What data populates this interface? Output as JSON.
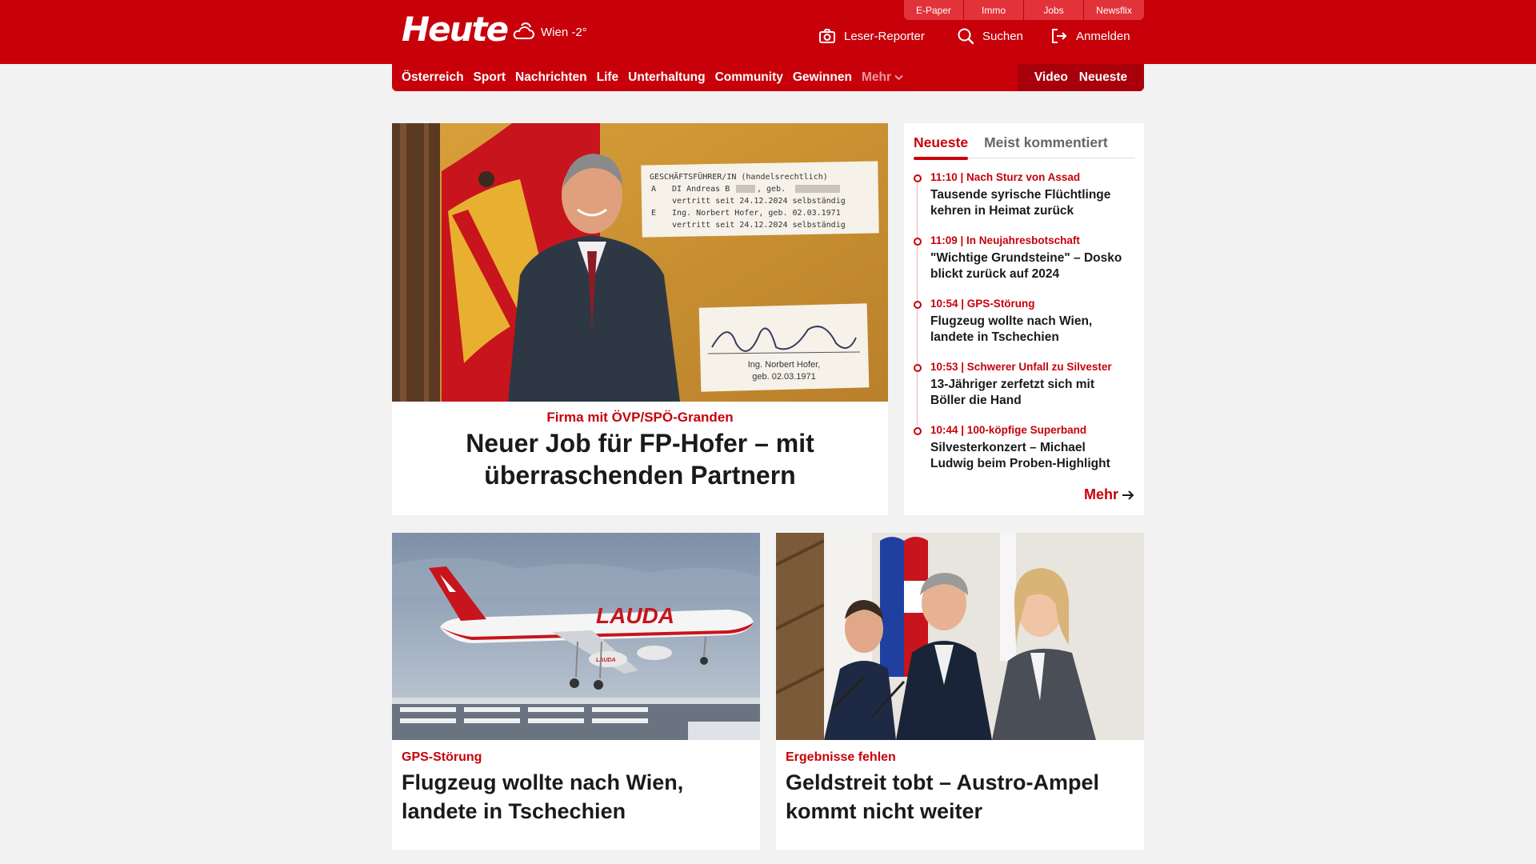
{
  "header": {
    "logo": "Heute",
    "weather": "Wien -2°",
    "service_links": [
      "E-Paper",
      "Immo",
      "Jobs",
      "Newsflix"
    ],
    "reporter": "Leser-Reporter",
    "search": "Suchen",
    "login": "Anmelden"
  },
  "nav": {
    "items": [
      "Österreich",
      "Sport",
      "Nachrichten",
      "Life",
      "Unterhaltung",
      "Community",
      "Gewinnen"
    ],
    "more": "Mehr",
    "video": "Video",
    "latest": "Neueste"
  },
  "lead": {
    "kicker": "Firma mit ÖVP/SPÖ-Granden",
    "title": "Neuer Job für FP-Hofer – mit überraschenden Partnern",
    "document": {
      "heading": "GESCHÄFTSFÜHRER/IN (handelsrechtlich)",
      "line_a_letter": "A",
      "line_a": "DI Andreas B",
      "line_a_suffix": ", geb.",
      "line_a2": "vertritt seit 24.12.2024 selbständig",
      "line_e_letter": "E",
      "line_e": "Ing. Norbert Hofer, geb. 02.03.1971",
      "line_e2": "vertritt seit 24.12.2024 selbständig",
      "sig_name": "Ing. Norbert Hofer,",
      "sig_date": "geb. 02.03.1971"
    }
  },
  "sidebar": {
    "tabs": [
      "Neueste",
      "Meist kommentiert"
    ],
    "news": [
      {
        "meta": "11:10 | Nach Sturz von Assad",
        "title": "Tausende syrische Flüchtlinge kehren in Heimat zurück"
      },
      {
        "meta": "11:09 | In Neujahresbotschaft",
        "title": "\"Wichtige Grundsteine\" – Dosko blickt zurück auf 2024"
      },
      {
        "meta": "10:54 | GPS-Störung",
        "title": "Flugzeug wollte nach Wien, landete in Tschechien"
      },
      {
        "meta": "10:53 | Schwerer Unfall zu Silvester",
        "title": "13-Jähriger zerfetzt sich mit Böller die Hand"
      },
      {
        "meta": "10:44 | 100-köpfige Superband",
        "title": "Silvesterkonzert – Michael Ludwig beim Proben-Highlight"
      }
    ],
    "more": "Mehr"
  },
  "cards": [
    {
      "kicker": "GPS-Störung",
      "title": "Flugzeug wollte nach Wien, landete in Tschechien",
      "livery": "LAUDA"
    },
    {
      "kicker": "Ergebnisse fehlen",
      "title": "Geldstreit tobt – Austro-Ampel kommt nicht weiter"
    }
  ],
  "colors": {
    "brand": "#c8000a",
    "background": "#f2f2f2"
  }
}
